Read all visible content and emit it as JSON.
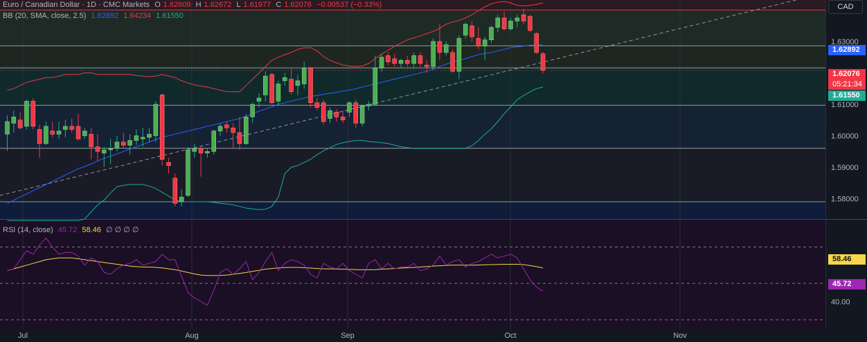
{
  "header": {
    "symbol_line": "Euro / Canadian Dollar · 1D · CMC Markets",
    "open_label": "O",
    "open": "1.62609",
    "high_label": "H",
    "high": "1.62672",
    "low_label": "L",
    "low": "1.61977",
    "close_label": "C",
    "close": "1.62076",
    "change": "−0.00537 (−0.33%)",
    "bb_label": "BB (20, SMA, close, 2.5)",
    "bb_basis": "1.62892",
    "bb_upper": "1.64234",
    "bb_lower": "1.61550",
    "rsi_label": "RSI (14, close)",
    "rsi_value": "45.72",
    "rsi_ma": "58.46",
    "rsi_placeholders": "∅ ∅ ∅ ∅"
  },
  "currency": "CAD",
  "price_tags": {
    "basis": "1.62892",
    "last": "1.62076",
    "countdown": "05:21:34",
    "lower": "1.61550",
    "rsi_ma": "58.46",
    "rsi": "45.72"
  },
  "colors": {
    "up": "#22ab94",
    "down": "#f23645",
    "basis": "#2962ff",
    "upper": "#f23645",
    "lower": "#22ab94",
    "rsi": "#9c27b0",
    "rsi_ma": "#f7d64b"
  },
  "chart_data": {
    "type": "candlestick",
    "price_axis": {
      "ylim": [
        1.5735,
        1.6432
      ],
      "ticks": [
        "1.64000",
        "1.63000",
        "1.62000",
        "1.61000",
        "1.60000",
        "1.59000",
        "1.58000"
      ]
    },
    "rsi_axis": {
      "ylim": [
        25,
        85
      ],
      "ticks": [
        "40.00"
      ]
    },
    "time_labels": [
      "Jul",
      "Aug",
      "Sep",
      "Oct",
      "Nov"
    ],
    "horizontal_levels": [
      1.64,
      1.6286,
      1.6216,
      1.6097,
      1.596,
      1.579
    ],
    "candles": [
      {
        "o": 1.6005,
        "h": 1.6065,
        "l": 1.5952,
        "c": 1.6045
      },
      {
        "o": 1.604,
        "h": 1.608,
        "l": 1.601,
        "c": 1.606
      },
      {
        "o": 1.605,
        "h": 1.6075,
        "l": 1.602,
        "c": 1.6025
      },
      {
        "o": 1.603,
        "h": 1.6115,
        "l": 1.602,
        "c": 1.611
      },
      {
        "o": 1.611,
        "h": 1.612,
        "l": 1.602,
        "c": 1.603
      },
      {
        "o": 1.602,
        "h": 1.6035,
        "l": 1.593,
        "c": 1.5975
      },
      {
        "o": 1.5975,
        "h": 1.6045,
        "l": 1.597,
        "c": 1.603
      },
      {
        "o": 1.6015,
        "h": 1.6045,
        "l": 1.5995,
        "c": 1.6005
      },
      {
        "o": 1.6005,
        "h": 1.6045,
        "l": 1.599,
        "c": 1.6015
      },
      {
        "o": 1.602,
        "h": 1.605,
        "l": 1.5995,
        "c": 1.603
      },
      {
        "o": 1.603,
        "h": 1.6055,
        "l": 1.601,
        "c": 1.602
      },
      {
        "o": 1.603,
        "h": 1.607,
        "l": 1.5985,
        "c": 1.599
      },
      {
        "o": 1.6,
        "h": 1.6025,
        "l": 1.599,
        "c": 1.6015
      },
      {
        "o": 1.6005,
        "h": 1.6025,
        "l": 1.5925,
        "c": 1.5965
      },
      {
        "o": 1.5965,
        "h": 1.6005,
        "l": 1.592,
        "c": 1.595
      },
      {
        "o": 1.5945,
        "h": 1.5965,
        "l": 1.59,
        "c": 1.5955
      },
      {
        "o": 1.5955,
        "h": 1.599,
        "l": 1.591,
        "c": 1.596
      },
      {
        "o": 1.596,
        "h": 1.6,
        "l": 1.595,
        "c": 1.598
      },
      {
        "o": 1.598,
        "h": 1.601,
        "l": 1.596,
        "c": 1.597
      },
      {
        "o": 1.597,
        "h": 1.6005,
        "l": 1.594,
        "c": 1.5985
      },
      {
        "o": 1.5985,
        "h": 1.602,
        "l": 1.597,
        "c": 1.6
      },
      {
        "o": 1.599,
        "h": 1.6025,
        "l": 1.5965,
        "c": 1.5995
      },
      {
        "o": 1.5995,
        "h": 1.6025,
        "l": 1.598,
        "c": 1.6005
      },
      {
        "o": 1.6,
        "h": 1.611,
        "l": 1.598,
        "c": 1.61
      },
      {
        "o": 1.613,
        "h": 1.6135,
        "l": 1.5905,
        "c": 1.5925
      },
      {
        "o": 1.5915,
        "h": 1.593,
        "l": 1.588,
        "c": 1.5905
      },
      {
        "o": 1.5865,
        "h": 1.588,
        "l": 1.5775,
        "c": 1.5785
      },
      {
        "o": 1.579,
        "h": 1.583,
        "l": 1.5775,
        "c": 1.5805
      },
      {
        "o": 1.581,
        "h": 1.5965,
        "l": 1.5805,
        "c": 1.5955
      },
      {
        "o": 1.595,
        "h": 1.5975,
        "l": 1.593,
        "c": 1.596
      },
      {
        "o": 1.596,
        "h": 1.5965,
        "l": 1.587,
        "c": 1.5945
      },
      {
        "o": 1.5945,
        "h": 1.596,
        "l": 1.593,
        "c": 1.595
      },
      {
        "o": 1.595,
        "h": 1.602,
        "l": 1.594,
        "c": 1.6015
      },
      {
        "o": 1.6015,
        "h": 1.604,
        "l": 1.6,
        "c": 1.603
      },
      {
        "o": 1.6035,
        "h": 1.6045,
        "l": 1.601,
        "c": 1.6025
      },
      {
        "o": 1.6025,
        "h": 1.604,
        "l": 1.596,
        "c": 1.601
      },
      {
        "o": 1.601,
        "h": 1.606,
        "l": 1.5955,
        "c": 1.5975
      },
      {
        "o": 1.5975,
        "h": 1.607,
        "l": 1.597,
        "c": 1.606
      },
      {
        "o": 1.606,
        "h": 1.6105,
        "l": 1.604,
        "c": 1.61
      },
      {
        "o": 1.611,
        "h": 1.6135,
        "l": 1.609,
        "c": 1.612
      },
      {
        "o": 1.613,
        "h": 1.6205,
        "l": 1.611,
        "c": 1.619
      },
      {
        "o": 1.6195,
        "h": 1.62,
        "l": 1.61,
        "c": 1.6105
      },
      {
        "o": 1.611,
        "h": 1.6175,
        "l": 1.61,
        "c": 1.6165
      },
      {
        "o": 1.6175,
        "h": 1.62,
        "l": 1.616,
        "c": 1.6185
      },
      {
        "o": 1.618,
        "h": 1.6215,
        "l": 1.613,
        "c": 1.614
      },
      {
        "o": 1.616,
        "h": 1.6195,
        "l": 1.613,
        "c": 1.6175
      },
      {
        "o": 1.6165,
        "h": 1.6235,
        "l": 1.615,
        "c": 1.6215
      },
      {
        "o": 1.6215,
        "h": 1.622,
        "l": 1.609,
        "c": 1.6105
      },
      {
        "o": 1.6105,
        "h": 1.612,
        "l": 1.608,
        "c": 1.609
      },
      {
        "o": 1.6105,
        "h": 1.6115,
        "l": 1.6035,
        "c": 1.6045
      },
      {
        "o": 1.6055,
        "h": 1.609,
        "l": 1.604,
        "c": 1.608
      },
      {
        "o": 1.6075,
        "h": 1.6085,
        "l": 1.6045,
        "c": 1.606
      },
      {
        "o": 1.606,
        "h": 1.608,
        "l": 1.604,
        "c": 1.605
      },
      {
        "o": 1.6075,
        "h": 1.611,
        "l": 1.606,
        "c": 1.6105
      },
      {
        "o": 1.6105,
        "h": 1.6115,
        "l": 1.6025,
        "c": 1.604
      },
      {
        "o": 1.604,
        "h": 1.61,
        "l": 1.603,
        "c": 1.6095
      },
      {
        "o": 1.6095,
        "h": 1.611,
        "l": 1.608,
        "c": 1.61
      },
      {
        "o": 1.61,
        "h": 1.6255,
        "l": 1.6095,
        "c": 1.6215
      },
      {
        "o": 1.6215,
        "h": 1.626,
        "l": 1.6205,
        "c": 1.625
      },
      {
        "o": 1.6255,
        "h": 1.6265,
        "l": 1.6225,
        "c": 1.6235
      },
      {
        "o": 1.6245,
        "h": 1.626,
        "l": 1.622,
        "c": 1.623
      },
      {
        "o": 1.623,
        "h": 1.6245,
        "l": 1.6215,
        "c": 1.624
      },
      {
        "o": 1.624,
        "h": 1.6255,
        "l": 1.622,
        "c": 1.623
      },
      {
        "o": 1.623,
        "h": 1.6265,
        "l": 1.6215,
        "c": 1.6255
      },
      {
        "o": 1.6255,
        "h": 1.6265,
        "l": 1.622,
        "c": 1.623
      },
      {
        "o": 1.6225,
        "h": 1.624,
        "l": 1.62,
        "c": 1.622
      },
      {
        "o": 1.622,
        "h": 1.631,
        "l": 1.621,
        "c": 1.63
      },
      {
        "o": 1.63,
        "h": 1.6355,
        "l": 1.624,
        "c": 1.6265
      },
      {
        "o": 1.6265,
        "h": 1.63,
        "l": 1.6255,
        "c": 1.629
      },
      {
        "o": 1.6265,
        "h": 1.6275,
        "l": 1.62,
        "c": 1.6205
      },
      {
        "o": 1.6205,
        "h": 1.632,
        "l": 1.618,
        "c": 1.631
      },
      {
        "o": 1.632,
        "h": 1.636,
        "l": 1.631,
        "c": 1.6355
      },
      {
        "o": 1.635,
        "h": 1.6365,
        "l": 1.63,
        "c": 1.6315
      },
      {
        "o": 1.631,
        "h": 1.6345,
        "l": 1.6275,
        "c": 1.6285
      },
      {
        "o": 1.6285,
        "h": 1.6315,
        "l": 1.624,
        "c": 1.6305
      },
      {
        "o": 1.6305,
        "h": 1.635,
        "l": 1.6295,
        "c": 1.6345
      },
      {
        "o": 1.6345,
        "h": 1.6385,
        "l": 1.633,
        "c": 1.6375
      },
      {
        "o": 1.6375,
        "h": 1.6395,
        "l": 1.6335,
        "c": 1.634
      },
      {
        "o": 1.634,
        "h": 1.6375,
        "l": 1.6335,
        "c": 1.6365
      },
      {
        "o": 1.6365,
        "h": 1.6385,
        "l": 1.6345,
        "c": 1.6375
      },
      {
        "o": 1.6385,
        "h": 1.6405,
        "l": 1.6355,
        "c": 1.6365
      },
      {
        "o": 1.638,
        "h": 1.6385,
        "l": 1.633,
        "c": 1.6335
      },
      {
        "o": 1.6325,
        "h": 1.633,
        "l": 1.626,
        "c": 1.6265
      },
      {
        "o": 1.6261,
        "h": 1.6267,
        "l": 1.6198,
        "c": 1.6208
      }
    ],
    "bb_upper": [
      1.6145,
      1.615,
      1.616,
      1.617,
      1.6175,
      1.618,
      1.6185,
      1.6185,
      1.619,
      1.6195,
      1.6195,
      1.6195,
      1.62,
      1.62,
      1.6195,
      1.6195,
      1.6195,
      1.6195,
      1.6195,
      1.6195,
      1.6192,
      1.619,
      1.6188,
      1.619,
      1.6195,
      1.619,
      1.6185,
      1.6175,
      1.6168,
      1.6162,
      1.6158,
      1.6155,
      1.615,
      1.6145,
      1.614,
      1.614,
      1.614,
      1.616,
      1.618,
      1.62,
      1.622,
      1.624,
      1.625,
      1.6258,
      1.6265,
      1.6275,
      1.628,
      1.628,
      1.627,
      1.6252,
      1.624,
      1.6232,
      1.6225,
      1.6222,
      1.622,
      1.6222,
      1.623,
      1.6245,
      1.626,
      1.6272,
      1.6285,
      1.6295,
      1.6305,
      1.6312,
      1.6318,
      1.6325,
      1.6332,
      1.6342,
      1.6355,
      1.6362,
      1.6367,
      1.6375,
      1.6385,
      1.6398,
      1.641,
      1.642,
      1.6425,
      1.6427,
      1.6423,
      1.6415,
      1.6413,
      1.6415,
      1.6418,
      1.6423
    ],
    "bb_basis": [
      1.5785,
      1.5795,
      1.5805,
      1.5815,
      1.5825,
      1.5835,
      1.5845,
      1.5855,
      1.5865,
      1.5875,
      1.5885,
      1.5895,
      1.5902,
      1.591,
      1.592,
      1.5928,
      1.5935,
      1.5942,
      1.595,
      1.5958,
      1.5965,
      1.5972,
      1.598,
      1.5988,
      1.5995,
      1.6,
      1.6005,
      1.601,
      1.6015,
      1.602,
      1.6025,
      1.603,
      1.6035,
      1.604,
      1.6045,
      1.605,
      1.6055,
      1.6062,
      1.607,
      1.6078,
      1.6085,
      1.6092,
      1.61,
      1.6105,
      1.611,
      1.6115,
      1.612,
      1.6125,
      1.6128,
      1.6132,
      1.6135,
      1.6138,
      1.6142,
      1.6145,
      1.615,
      1.6155,
      1.616,
      1.6165,
      1.617,
      1.6175,
      1.618,
      1.6185,
      1.619,
      1.6195,
      1.62,
      1.6205,
      1.6212,
      1.622,
      1.6228,
      1.6235,
      1.624,
      1.6245,
      1.6252,
      1.6258,
      1.6262,
      1.6265,
      1.627,
      1.6275,
      1.628,
      1.6283,
      1.6285,
      1.6288,
      1.629,
      1.6289
    ],
    "bb_lower": [
      1.573,
      1.573,
      1.573,
      1.573,
      1.573,
      1.573,
      1.573,
      1.573,
      1.573,
      1.573,
      1.573,
      1.573,
      1.5735,
      1.5758,
      1.578,
      1.5795,
      1.5818,
      1.5838,
      1.5842,
      1.5845,
      1.5845,
      1.5845,
      1.584,
      1.5832,
      1.582,
      1.5808,
      1.5795,
      1.579,
      1.579,
      1.579,
      1.579,
      1.579,
      1.5788,
      1.5785,
      1.5783,
      1.578,
      1.5775,
      1.577,
      1.5767,
      1.5765,
      1.5766,
      1.5775,
      1.5805,
      1.588,
      1.59,
      1.5905,
      1.5915,
      1.5925,
      1.594,
      1.5952,
      1.5962,
      1.5972,
      1.5978,
      1.5982,
      1.5985,
      1.5985,
      1.5982,
      1.598,
      1.5978,
      1.5975,
      1.597,
      1.5965,
      1.5962,
      1.596,
      1.596,
      1.596,
      1.596,
      1.596,
      1.596,
      1.596,
      1.596,
      1.596,
      1.5968,
      1.5985,
      1.6005,
      1.6022,
      1.6045,
      1.607,
      1.6092,
      1.6115,
      1.6128,
      1.614,
      1.615,
      1.6155
    ],
    "rsi": [
      57,
      58,
      63,
      68,
      66,
      71,
      75,
      70,
      66,
      67,
      67,
      65,
      60,
      64,
      62,
      56,
      55,
      58,
      60,
      61,
      63,
      60,
      61,
      62,
      66,
      63,
      63,
      54,
      45,
      42,
      40,
      38,
      46,
      56,
      58,
      55,
      58,
      62,
      52,
      56,
      62,
      67,
      57,
      61,
      63,
      62,
      60,
      55,
      53,
      61,
      59,
      58,
      61,
      57,
      55,
      53,
      61,
      63,
      58,
      61,
      58,
      59,
      59,
      61,
      57,
      58,
      60,
      65,
      60,
      62,
      63,
      59,
      61,
      62,
      64,
      66,
      64,
      65,
      66,
      64,
      58,
      52,
      48,
      45.72
    ],
    "rsi_ma": [
      57,
      58,
      59,
      60,
      61,
      62,
      63,
      63.5,
      64,
      64,
      64,
      63.5,
      63,
      62.5,
      62,
      61.5,
      61,
      60.5,
      60,
      59.5,
      59.2,
      59,
      59,
      58.8,
      58.5,
      58,
      57.5,
      56.8,
      56,
      55.2,
      54.6,
      54.3,
      54.3,
      54.4,
      54.6,
      55,
      55.5,
      56,
      56.6,
      57.2,
      57.8,
      58.2,
      58.5,
      58.7,
      58.8,
      58.8,
      58.6,
      58.4,
      58.2,
      58,
      58,
      57.9,
      57.8,
      57.7,
      57.6,
      57.5,
      57.5,
      57.6,
      57.8,
      58,
      58.2,
      58.4,
      58.6,
      58.8,
      59,
      59.2,
      59.5,
      59.7,
      59.9,
      60,
      60,
      60,
      60,
      60.1,
      60.2,
      60.3,
      60.4,
      60.5,
      60.5,
      60.5,
      60.3,
      59.8,
      59.2,
      58.46
    ]
  }
}
